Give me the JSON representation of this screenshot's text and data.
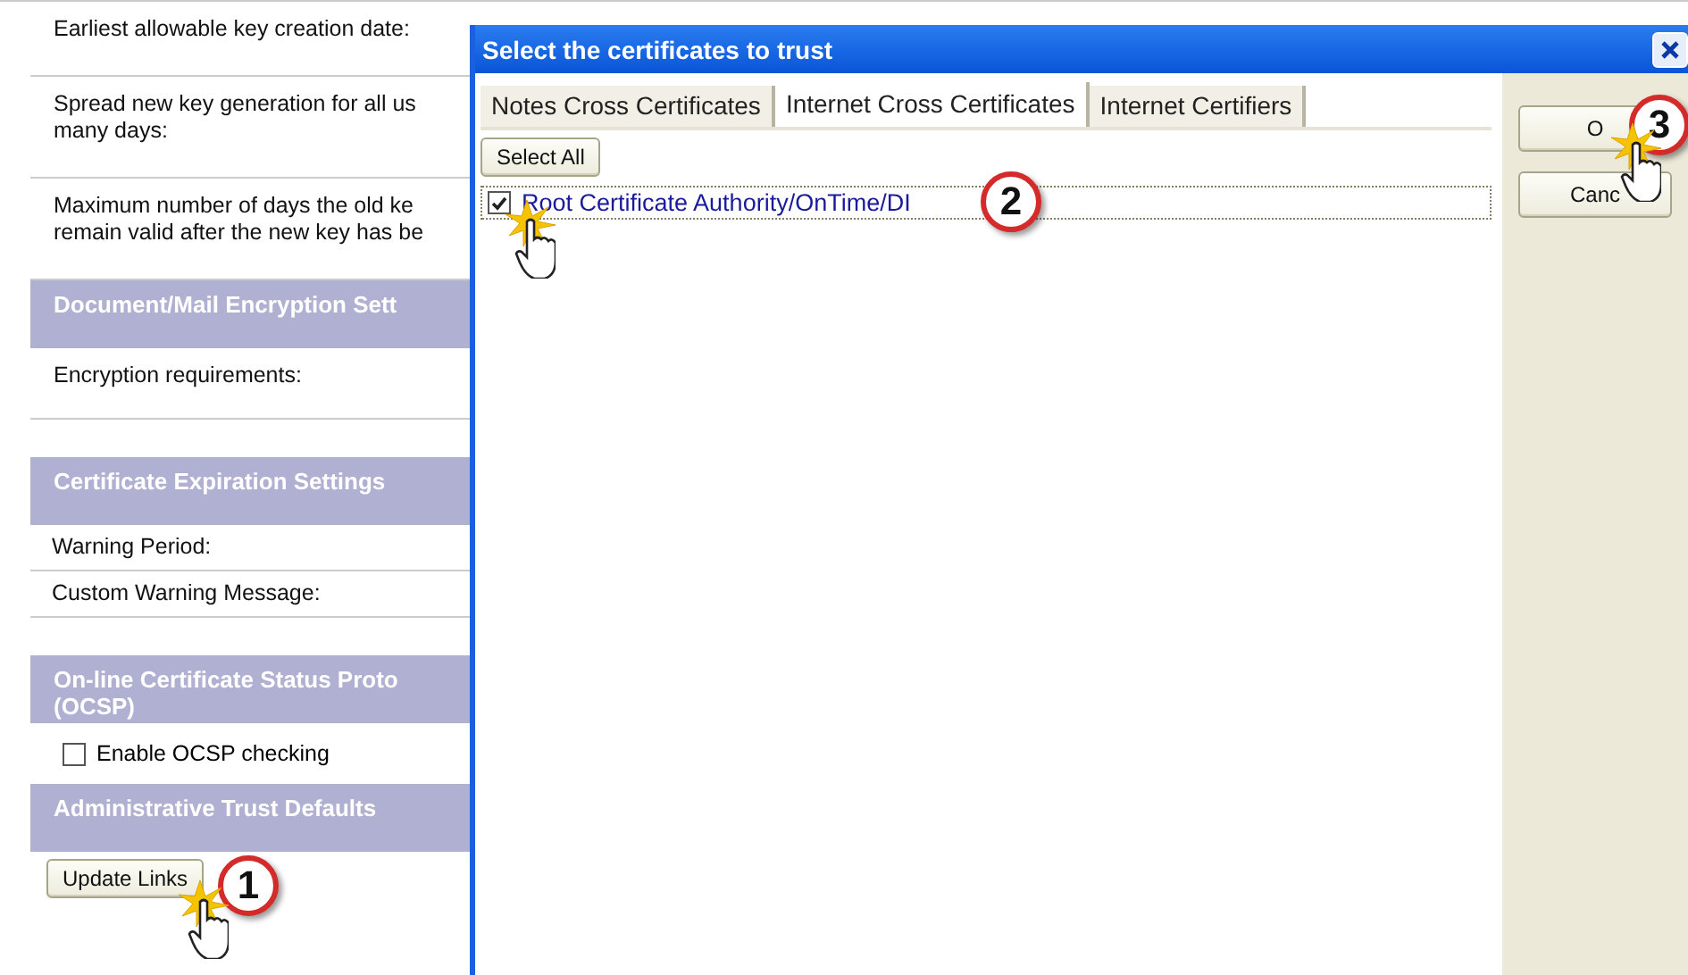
{
  "settings": {
    "rows": [
      {
        "kind": "field",
        "lines": [
          "Earliest allowable key creation date:"
        ]
      },
      {
        "kind": "field",
        "lines": [
          "Spread new key generation for all us",
          "many days:"
        ]
      },
      {
        "kind": "field",
        "lines": [
          "Maximum number of days the old ke",
          "remain valid after the new key has be"
        ]
      },
      {
        "kind": "header",
        "lines": [
          "Document/Mail Encryption Sett"
        ]
      },
      {
        "kind": "field",
        "lines": [
          "Encryption requirements:"
        ]
      },
      {
        "kind": "header",
        "lines": [
          "Certificate Expiration Settings"
        ]
      },
      {
        "kind": "short",
        "lines": [
          "Warning Period:"
        ]
      },
      {
        "kind": "short",
        "lines": [
          "Custom Warning Message:"
        ]
      },
      {
        "kind": "header",
        "lines": [
          "On-line Certificate Status Proto",
          "(OCSP)"
        ]
      },
      {
        "kind": "checkbox",
        "lines": [
          "Enable OCSP checking"
        ],
        "checked": false
      },
      {
        "kind": "header",
        "lines": [
          "Administrative Trust Defaults"
        ]
      },
      {
        "kind": "button",
        "lines": [
          "Update Links"
        ],
        "callout": "1"
      }
    ]
  },
  "dialog": {
    "title": "Select the certificates to trust",
    "tabs": [
      {
        "label": "Notes Cross Certificates",
        "selected": false
      },
      {
        "label": "Internet Cross Certificates",
        "selected": true
      },
      {
        "label": "Internet Certifiers",
        "selected": false
      }
    ],
    "select_all": "Select All",
    "certificates": [
      {
        "label": "Root Certificate Authority/OnTime/DI",
        "checked": true,
        "callout": "2"
      }
    ],
    "buttons": [
      {
        "label": "O",
        "callout": "3"
      },
      {
        "label": "Canc"
      }
    ]
  }
}
